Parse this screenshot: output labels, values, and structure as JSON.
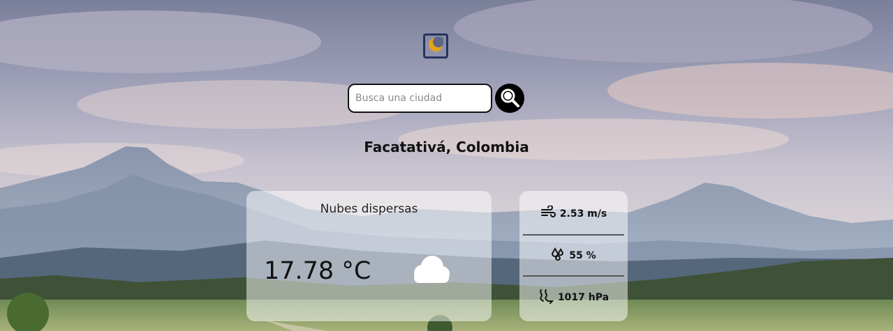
{
  "background": {
    "description_icon": "mountain-landscape-background"
  },
  "theme_toggle": {
    "icon": "moon-icon"
  },
  "search": {
    "placeholder": "Busca una ciudad",
    "value": "",
    "button_icon": "search-icon"
  },
  "location": {
    "title": "Facatativá, Colombia"
  },
  "weather": {
    "description": "Nubes dispersas",
    "temperature": "17.78 °C",
    "icon": "cloud-icon"
  },
  "stats": {
    "wind": {
      "icon": "wind-icon",
      "value": "2.53 m/s"
    },
    "humidity": {
      "icon": "humidity-icon",
      "value": "55 %"
    },
    "pressure": {
      "icon": "pressure-icon",
      "value": "1017 hPa"
    }
  },
  "colors": {
    "toggle_border": "#26335d",
    "moon": "#e6a21c",
    "search_button": "#000000",
    "card_bg": "rgba(255,255,255,0.5)"
  }
}
